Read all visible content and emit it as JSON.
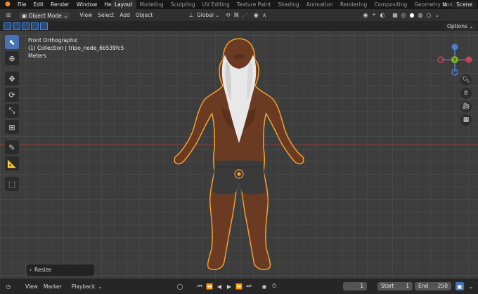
{
  "menu": [
    "File",
    "Edit",
    "Render",
    "Window",
    "Help"
  ],
  "workspace_tabs": [
    {
      "label": "Layout",
      "active": true
    },
    {
      "label": "Modeling",
      "active": false
    },
    {
      "label": "Sculpting",
      "active": false
    },
    {
      "label": "UV Editing",
      "active": false
    },
    {
      "label": "Texture Paint",
      "active": false
    },
    {
      "label": "Shading",
      "active": false
    },
    {
      "label": "Animation",
      "active": false
    },
    {
      "label": "Rendering",
      "active": false
    },
    {
      "label": "Compositing",
      "active": false
    },
    {
      "label": "Geometry Node",
      "active": false
    }
  ],
  "scene_name": "Scene",
  "header": {
    "mode": "Object Mode",
    "menus": [
      "View",
      "Select",
      "Add",
      "Object"
    ],
    "transform_orientation": "Global"
  },
  "viewport": {
    "view_name": "Front Orthographic",
    "collection_info": "(1) Collection | tripo_node_6b539fc5",
    "units": "Meters",
    "options_label": "Options",
    "last_operator": "Resize",
    "gizmo_axis_label": "Y"
  },
  "timeline": {
    "menus": [
      "View",
      "Marker",
      "Playback"
    ],
    "current_frame": "1",
    "start_label": "Start",
    "start_value": "1",
    "end_label": "End",
    "end_value": "250"
  },
  "colors": {
    "accent": "#4772b3",
    "selection_outline": "#f0a030",
    "x_axis": "#9b3b3b",
    "skin": "#6b3a22",
    "hair": "#e8e8e8",
    "shorts": "#3a3a3a"
  }
}
